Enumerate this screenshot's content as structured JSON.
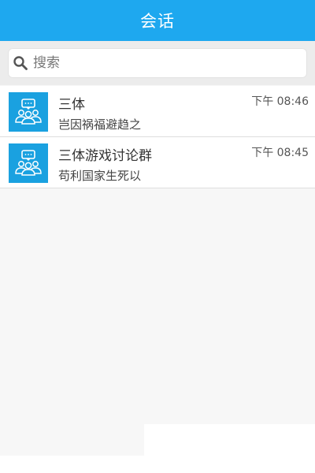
{
  "header": {
    "title": "会话"
  },
  "search": {
    "placeholder": "搜索",
    "icon": "search-icon",
    "value": ""
  },
  "conversations": [
    {
      "name": "三体",
      "last_message": "岂因祸福避趋之",
      "time": "下午 08:46",
      "icon": "group-chat-icon"
    },
    {
      "name": "三体游戏讨论群",
      "last_message": "苟利国家生死以",
      "time": "下午 08:45",
      "icon": "group-chat-icon"
    }
  ],
  "colors": {
    "header_background": "#1ea8ef",
    "avatar_background": "#1aa1e0",
    "search_bar_background": "#ececec",
    "page_background": "#f7f7f7"
  }
}
